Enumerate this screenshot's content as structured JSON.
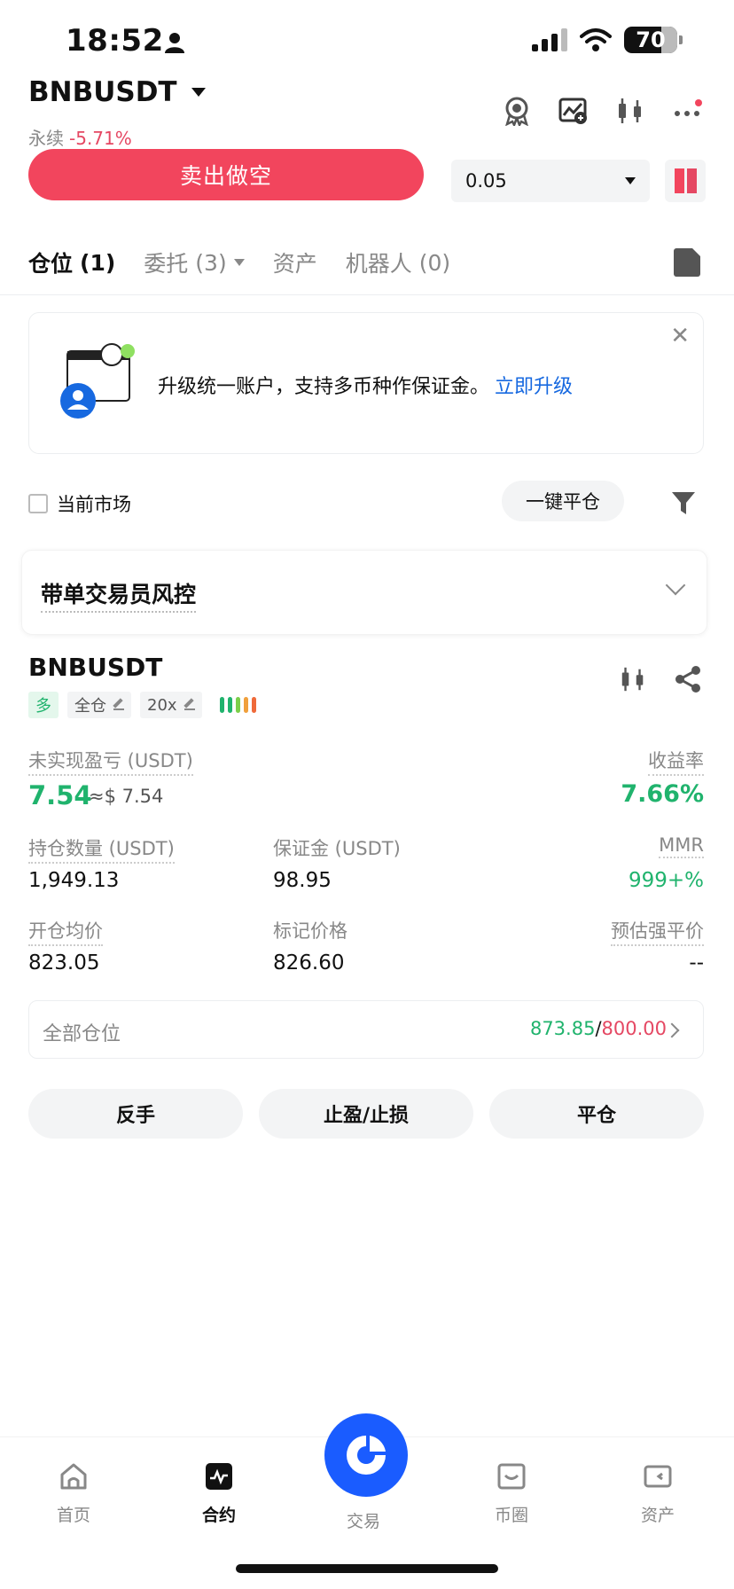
{
  "status_bar": {
    "time": "18:52",
    "battery": "70"
  },
  "header": {
    "symbol": "BNBUSDT",
    "contract_type": "永续",
    "change_pct": "-5.71%",
    "icons": [
      "award-icon",
      "chart-alert-icon",
      "candlestick-icon",
      "more-icon"
    ]
  },
  "order": {
    "sell_label": "卖出做空",
    "quantity_value": "0.05"
  },
  "tabs": [
    {
      "label": "仓位",
      "count": "(1)"
    },
    {
      "label": "委托",
      "count": "(3)"
    },
    {
      "label": "资产",
      "count": ""
    },
    {
      "label": "机器人",
      "count": "(0)"
    }
  ],
  "banner": {
    "text": "升级统一账户，支持多币种作保证金。",
    "link": "立即升级"
  },
  "filters": {
    "current_market": "当前市场",
    "close_all": "一键平仓"
  },
  "risk_section": {
    "title": "带单交易员风控"
  },
  "position": {
    "symbol": "BNBUSDT",
    "side": "多",
    "margin_mode": "全仓",
    "leverage": "20x",
    "pnl_label": "未实现盈亏 (USDT)",
    "pnl_value": "7.54",
    "pnl_approx": "≈$ 7.54",
    "roe_label": "收益率",
    "roe_value": "7.66%",
    "size_label": "持仓数量 (USDT)",
    "size_value": "1,949.13",
    "margin_label": "保证金 (USDT)",
    "margin_value": "98.95",
    "mmr_label": "MMR",
    "mmr_value": "999+%",
    "entry_label": "开仓均价",
    "entry_value": "823.05",
    "mark_label": "标记价格",
    "mark_value": "826.60",
    "liq_label": "预估强平价",
    "liq_value": "--"
  },
  "all_positions": {
    "label": "全部仓位",
    "profit": "873.85",
    "separator": "/",
    "loss": "800.00"
  },
  "actions": {
    "reverse": "反手",
    "tpsl": "止盈/止损",
    "close": "平仓"
  },
  "bottom_nav": [
    {
      "label": "首页",
      "icon": "home-icon"
    },
    {
      "label": "合约",
      "icon": "futures-icon"
    },
    {
      "label": "交易",
      "icon": "trade-icon"
    },
    {
      "label": "币圈",
      "icon": "square-icon"
    },
    {
      "label": "资产",
      "icon": "wallet-icon"
    }
  ],
  "colors": {
    "sell": "#f2455d",
    "profit_green": "#20b36d",
    "loss_red": "#e54863",
    "link_blue": "#1769e0",
    "trade_fab": "#1a5cff"
  }
}
